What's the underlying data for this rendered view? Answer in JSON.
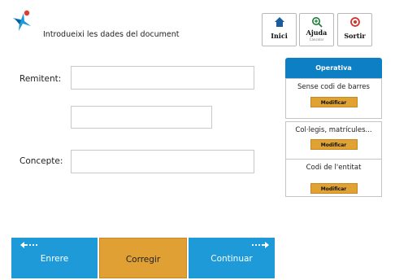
{
  "header": {
    "title": "Introdueixi les dades del document"
  },
  "top_buttons": {
    "inici": {
      "label": "Inici"
    },
    "ajuda": {
      "label": "Ajuda",
      "sub": "Cancelar"
    },
    "sortir": {
      "label": "Sortir"
    }
  },
  "form": {
    "remitent_label": "Remitent:",
    "remitent_value": "",
    "remitent2_value": "",
    "concepte_label": "Concepte:",
    "concepte_value": ""
  },
  "operativa": {
    "title": "Operativa",
    "items": [
      {
        "label": "Sense codi de barres",
        "button": "Modificar"
      },
      {
        "label": "Col·legis, matrícules...",
        "button": "Modificar"
      },
      {
        "label": "Codi de l'entitat",
        "button": "Modificar"
      }
    ]
  },
  "nav": {
    "back_label": "Enrere",
    "correct_label": "Corregir",
    "continue_label": "Continuar"
  },
  "colors": {
    "primary_blue": "#1f9ad8",
    "header_blue": "#0d7fc4",
    "accent_orange": "#e0a033",
    "danger_red": "#d9302b",
    "help_green": "#1e7d3a"
  },
  "icons": {
    "logo": "star-logo-icon",
    "inici": "home-icon",
    "ajuda": "zoom-in-icon",
    "sortir": "exit-icon",
    "back": "arrow-left-icon",
    "next": "arrow-right-icon"
  }
}
